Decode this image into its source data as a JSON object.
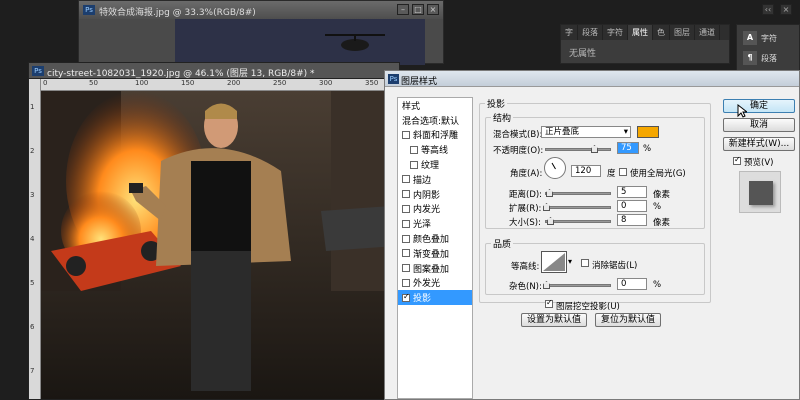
{
  "bg_document": {
    "title": "特效合成海报.jpg @ 33.3%(RGB/8#)",
    "ps_badge": "Ps"
  },
  "top_buttons": [
    "‹‹",
    "×"
  ],
  "panel_props": {
    "tabs": [
      "字",
      "段落",
      "字符",
      "属性",
      "色",
      "图层",
      "通道"
    ],
    "active_tab": 3,
    "content": "无属性"
  },
  "panel_glyph": {
    "items": [
      {
        "glyph": "A",
        "label": "字符"
      },
      {
        "glyph": "¶",
        "label": "段落"
      }
    ]
  },
  "main_document": {
    "title": "city-street-1082031_1920.jpg @ 46.1% (图层 13, RGB/8#) *",
    "ps_badge": "Ps",
    "ruler_top": [
      "0",
      "50",
      "100",
      "150",
      "200",
      "250",
      "300",
      "350"
    ],
    "ruler_left": [
      "1",
      "2",
      "3",
      "4",
      "5",
      "6",
      "7"
    ]
  },
  "dialog": {
    "title": "图层样式",
    "ps_badge": "Ps",
    "style_list": [
      {
        "label": "样式",
        "kind": "hdr"
      },
      {
        "label": "混合选项:默认",
        "kind": "hdr"
      },
      {
        "label": "斜面和浮雕",
        "kind": "cb",
        "checked": false
      },
      {
        "label": "等高线",
        "kind": "sub",
        "checked": false
      },
      {
        "label": "纹理",
        "kind": "sub",
        "checked": false
      },
      {
        "label": "描边",
        "kind": "cb",
        "checked": false
      },
      {
        "label": "内阴影",
        "kind": "cb",
        "checked": false
      },
      {
        "label": "内发光",
        "kind": "cb",
        "checked": false
      },
      {
        "label": "光泽",
        "kind": "cb",
        "checked": false
      },
      {
        "label": "颜色叠加",
        "kind": "cb",
        "checked": false
      },
      {
        "label": "渐变叠加",
        "kind": "cb",
        "checked": false
      },
      {
        "label": "图案叠加",
        "kind": "cb",
        "checked": false
      },
      {
        "label": "外发光",
        "kind": "cb",
        "checked": false
      },
      {
        "label": "投影",
        "kind": "cb",
        "checked": true,
        "selected": true
      }
    ],
    "shadow": {
      "title": "投影",
      "structure_title": "结构",
      "blend_mode_label": "混合模式(B):",
      "blend_mode_value": "正片叠底",
      "shadow_color": "#f5a700",
      "opacity_label": "不透明度(O):",
      "opacity_value": "75",
      "opacity_unit": "%",
      "opacity_level": 0.75,
      "angle_label": "角度(A):",
      "angle_value": "120",
      "angle_unit": "度",
      "global_light_label": "使用全局光(G)",
      "global_light_checked": false,
      "distance_label": "距离(D):",
      "distance_value": "5",
      "distance_unit": "像素",
      "spread_label": "扩展(R):",
      "spread_value": "0",
      "spread_unit": "%",
      "size_label": "大小(S):",
      "size_value": "8",
      "size_unit": "像素",
      "quality_title": "品质",
      "contour_label": "等高线:",
      "antialias_label": "消除锯齿(L)",
      "antialias_checked": false,
      "noise_label": "杂色(N):",
      "noise_value": "0",
      "noise_unit": "%",
      "knockout_label": "图层挖空投影(U)",
      "knockout_checked": true,
      "set_default_label": "设置为默认值",
      "reset_default_label": "复位为默认值"
    },
    "buttons": {
      "ok": "确定",
      "cancel": "取消",
      "new_style": "新建样式(W)...",
      "preview_label": "预览(V)",
      "preview_checked": true
    }
  }
}
